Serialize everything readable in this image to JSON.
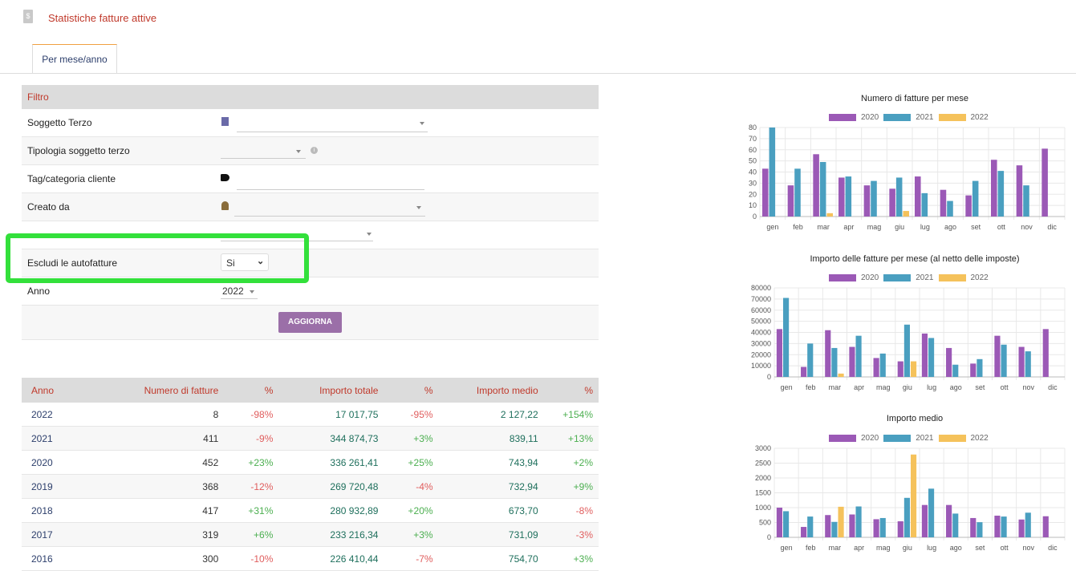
{
  "header": {
    "title": "Statistiche fatture attive",
    "icon": "invoice-icon"
  },
  "tabs": [
    {
      "label": "Per mese/anno"
    }
  ],
  "filter": {
    "title": "Filtro",
    "rows": {
      "soggetto": {
        "label": "Soggetto Terzo",
        "value": ""
      },
      "tipologia": {
        "label": "Tipologia soggetto terzo",
        "value": ""
      },
      "tag": {
        "label": "Tag/categoria cliente",
        "value": ""
      },
      "creato": {
        "label": "Creato da",
        "value": ""
      },
      "hidden": {
        "label": "",
        "value": ""
      },
      "escludi": {
        "label": "Escludi le autofatture",
        "value": "Si"
      },
      "anno": {
        "label": "Anno",
        "value": "2022"
      }
    },
    "button_label": "AGGIORNA"
  },
  "colors": {
    "2020": "#9b59b6",
    "2021": "#4a9fc0",
    "2022": "#f5c25b",
    "accent": "#c0392b",
    "highlight": "#33e03b"
  },
  "table": {
    "headers": [
      "Anno",
      "Numero di fatture",
      "%",
      "Importo totale",
      "%",
      "Importo medio",
      "%"
    ],
    "rows": [
      [
        "2022",
        "8",
        "-98%",
        "17 017,75",
        "-95%",
        "2 127,22",
        "+154%"
      ],
      [
        "2021",
        "411",
        "-9%",
        "344 874,73",
        "+3%",
        "839,11",
        "+13%"
      ],
      [
        "2020",
        "452",
        "+23%",
        "336 261,41",
        "+25%",
        "743,94",
        "+2%"
      ],
      [
        "2019",
        "368",
        "-12%",
        "269 720,48",
        "-4%",
        "732,94",
        "+9%"
      ],
      [
        "2018",
        "417",
        "+31%",
        "280 932,89",
        "+20%",
        "673,70",
        "-8%"
      ],
      [
        "2017",
        "319",
        "+6%",
        "233 216,34",
        "+3%",
        "731,09",
        "-3%"
      ],
      [
        "2016",
        "300",
        "-10%",
        "226 410,44",
        "-7%",
        "754,70",
        "+3%"
      ]
    ]
  },
  "chart_data": [
    {
      "type": "bar",
      "title": "Numero di fatture per mese",
      "categories": [
        "gen",
        "feb",
        "mar",
        "apr",
        "mag",
        "giu",
        "lug",
        "ago",
        "set",
        "ott",
        "nov",
        "dic"
      ],
      "series": [
        {
          "name": "2020",
          "values": [
            43,
            28,
            56,
            35,
            28,
            25,
            36,
            24,
            19,
            51,
            46,
            61
          ]
        },
        {
          "name": "2021",
          "values": [
            80,
            43,
            49,
            36,
            32,
            35,
            21,
            14,
            32,
            41,
            28,
            null
          ]
        },
        {
          "name": "2022",
          "values": [
            null,
            null,
            3,
            null,
            null,
            5,
            null,
            null,
            null,
            null,
            null,
            null
          ]
        }
      ],
      "yticks": [
        "0",
        "10",
        "20",
        "30",
        "40",
        "50",
        "60",
        "70",
        "80"
      ],
      "ylim": [
        0,
        80
      ],
      "legend": "top"
    },
    {
      "type": "bar",
      "title": "Importo delle fatture per mese (al netto delle imposte)",
      "categories": [
        "gen",
        "feb",
        "mar",
        "apr",
        "mag",
        "giu",
        "lug",
        "ago",
        "set",
        "ott",
        "nov",
        "dic"
      ],
      "series": [
        {
          "name": "2020",
          "values": [
            43000,
            9000,
            42000,
            27000,
            17000,
            14000,
            39000,
            26000,
            12000,
            37000,
            27000,
            43000
          ]
        },
        {
          "name": "2021",
          "values": [
            71000,
            30000,
            26000,
            37000,
            21000,
            47000,
            35000,
            11000,
            16000,
            29000,
            23000,
            null
          ]
        },
        {
          "name": "2022",
          "values": [
            null,
            null,
            3000,
            null,
            null,
            14000,
            null,
            null,
            null,
            null,
            null,
            null
          ]
        }
      ],
      "yticks": [
        "0",
        "10000",
        "20000",
        "30000",
        "40000",
        "50000",
        "60000",
        "70000",
        "80000"
      ],
      "ylim": [
        0,
        80000
      ],
      "legend": "top"
    },
    {
      "type": "bar",
      "title": "Importo medio",
      "categories": [
        "gen",
        "feb",
        "mar",
        "apr",
        "mag",
        "giu",
        "lug",
        "ago",
        "set",
        "ott",
        "nov",
        "dic"
      ],
      "series": [
        {
          "name": "2020",
          "values": [
            1000,
            350,
            750,
            770,
            610,
            540,
            1090,
            1090,
            650,
            730,
            600,
            710
          ]
        },
        {
          "name": "2021",
          "values": [
            880,
            700,
            520,
            1040,
            650,
            1330,
            1640,
            800,
            510,
            700,
            830,
            null
          ]
        },
        {
          "name": "2022",
          "values": [
            null,
            null,
            1030,
            null,
            null,
            2790,
            null,
            null,
            null,
            null,
            null,
            null
          ]
        }
      ],
      "yticks": [
        "0",
        "500",
        "1000",
        "1500",
        "2000",
        "2500",
        "3000"
      ],
      "ylim": [
        0,
        3000
      ],
      "legend": "top"
    }
  ]
}
